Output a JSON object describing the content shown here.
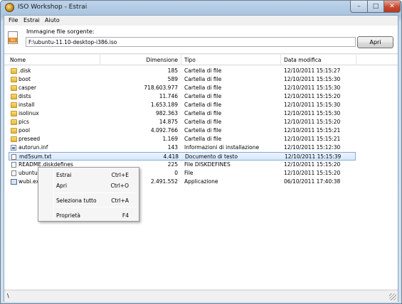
{
  "window": {
    "title": "ISO Workshop - Estrai",
    "controls": {
      "minimize": "–",
      "maximize": "□",
      "close": "✕"
    }
  },
  "menu": [
    {
      "label": "File"
    },
    {
      "label": "Estrai"
    },
    {
      "label": "Aiuto"
    }
  ],
  "source": {
    "label": "Immagine file sorgente:",
    "path": "F:\\ubuntu-11.10-desktop-i386.iso",
    "open_button": "Apri",
    "icon_tag": "ISO"
  },
  "columns": {
    "name": "Nome",
    "size": "Dimensione",
    "type": "Tipo",
    "date": "Data modifica"
  },
  "files": [
    {
      "name": ".disk",
      "size": "185",
      "type": "Cartella di file",
      "date": "12/10/2011 15:15:27",
      "icon": "folder-icon"
    },
    {
      "name": "boot",
      "size": "589",
      "type": "Cartella di file",
      "date": "12/10/2011 15:15:30",
      "icon": "folder-icon"
    },
    {
      "name": "casper",
      "size": "718.603.977",
      "type": "Cartella di file",
      "date": "12/10/2011 15:15:30",
      "icon": "folder-icon"
    },
    {
      "name": "dists",
      "size": "11.746",
      "type": "Cartella di file",
      "date": "12/10/2011 15:15:20",
      "icon": "folder-icon"
    },
    {
      "name": "install",
      "size": "1.653.189",
      "type": "Cartella di file",
      "date": "12/10/2011 15:15:30",
      "icon": "folder-icon"
    },
    {
      "name": "isolinux",
      "size": "982.363",
      "type": "Cartella di file",
      "date": "12/10/2011 15:15:30",
      "icon": "folder-icon"
    },
    {
      "name": "pics",
      "size": "14.875",
      "type": "Cartella di file",
      "date": "12/10/2011 15:15:20",
      "icon": "folder-icon"
    },
    {
      "name": "pool",
      "size": "4.092.766",
      "type": "Cartella di file",
      "date": "12/10/2011 15:15:21",
      "icon": "folder-icon"
    },
    {
      "name": "preseed",
      "size": "1.169",
      "type": "Cartella di file",
      "date": "12/10/2011 15:15:21",
      "icon": "folder-icon"
    },
    {
      "name": "autorun.inf",
      "size": "143",
      "type": "Informazioni di installazione",
      "date": "12/10/2011 15:12:30",
      "icon": "inf-icon"
    },
    {
      "name": "md5sum.txt",
      "size": "4.418",
      "type": "Documento di testo",
      "date": "12/10/2011 15:15:39",
      "icon": "file-icon",
      "selected": true
    },
    {
      "name": "README.diskdefines",
      "size": "225",
      "type": "File DISKDEFINES",
      "date": "12/10/2011 15:15:20",
      "icon": "file-icon"
    },
    {
      "name": "ubuntu",
      "size": "0",
      "type": "File",
      "date": "12/10/2011 15:15:20",
      "icon": "file-icon"
    },
    {
      "name": "wubi.exe",
      "size": "2.491.552",
      "type": "Applicazione",
      "date": "06/10/2011 17:40:38",
      "icon": "exe-icon"
    }
  ],
  "context_menu": [
    {
      "label": "Estrai",
      "shortcut": "Ctrl+E"
    },
    {
      "label": "Apri",
      "shortcut": "Ctrl+O"
    },
    {
      "label": "Seleziona tutto",
      "shortcut": "Ctrl+A"
    },
    {
      "label": "Proprietà",
      "shortcut": "F4"
    }
  ],
  "status": {
    "text": "\\"
  }
}
